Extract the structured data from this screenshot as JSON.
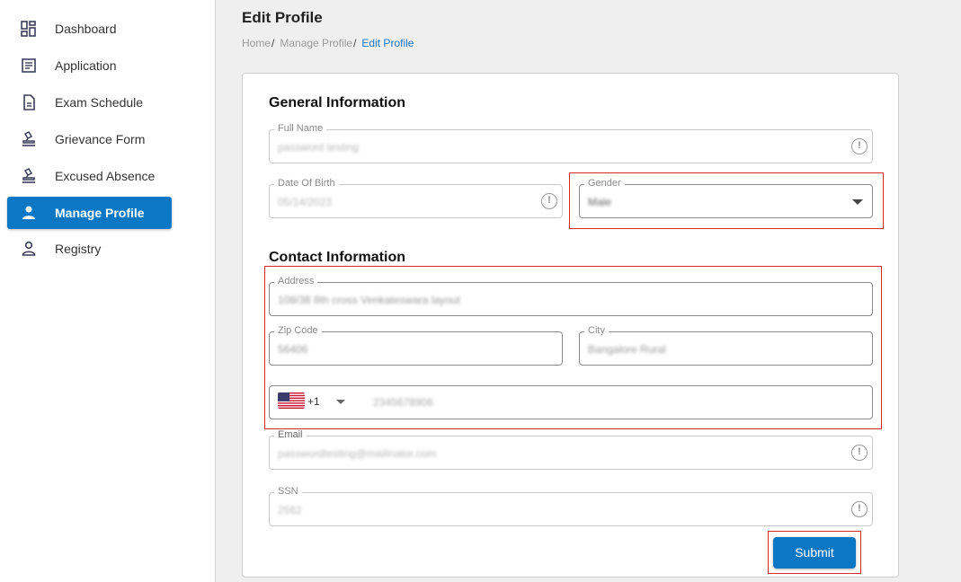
{
  "sidebar": {
    "items": [
      {
        "label": "Dashboard",
        "icon": "dashboard-icon"
      },
      {
        "label": "Application",
        "icon": "document-list-icon"
      },
      {
        "label": "Exam Schedule",
        "icon": "file-icon"
      },
      {
        "label": "Grievance Form",
        "icon": "stamp-icon"
      },
      {
        "label": "Excused Absence",
        "icon": "stamp-icon"
      },
      {
        "label": "Manage Profile",
        "icon": "person-icon",
        "active": true
      },
      {
        "label": "Registry",
        "icon": "person-outline-icon"
      }
    ]
  },
  "header": {
    "title": "Edit Profile",
    "breadcrumb": [
      "Home",
      "Manage Profile",
      "Edit Profile"
    ],
    "separator": "/"
  },
  "general": {
    "title": "General Information",
    "full_name": {
      "label": "Full Name",
      "value": "password testing"
    },
    "dob": {
      "label": "Date Of Birth",
      "value": "05/14/2023"
    },
    "gender": {
      "label": "Gender",
      "value": "Male"
    }
  },
  "contact": {
    "title": "Contact Information",
    "address": {
      "label": "Address",
      "value": "108/38 8th cross Venkateswara layout"
    },
    "zip": {
      "label": "Zip Code",
      "value": "56406"
    },
    "city": {
      "label": "City",
      "value": "Bangalore Rural"
    },
    "phone": {
      "country_code": "+1",
      "number": "2345678906"
    },
    "email": {
      "label": "Email",
      "value": "passwordtesting@mailinator.com"
    },
    "ssn": {
      "label": "SSN",
      "value": "2562"
    }
  },
  "actions": {
    "submit_label": "Submit"
  },
  "colors": {
    "accent": "#0b77c5",
    "highlight": "#d22b2b"
  }
}
